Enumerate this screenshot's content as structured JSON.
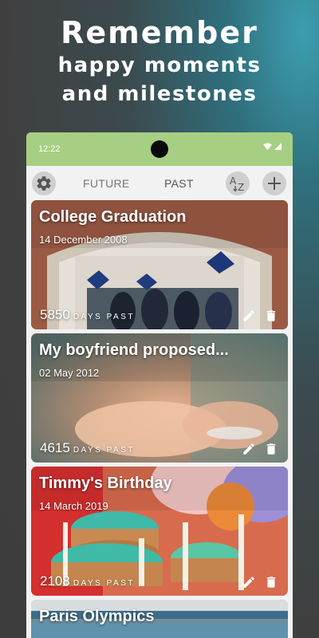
{
  "promo": {
    "title": "Remember",
    "line1": "happy moments",
    "line2": "and milestones"
  },
  "status": {
    "time": "12:22"
  },
  "tabs": {
    "future": "FUTURE",
    "past": "PAST",
    "active": "past"
  },
  "icons": {
    "settings": "gear-icon",
    "sort": "sort-az-icon",
    "add": "plus-icon",
    "edit": "pencil-icon",
    "delete": "trash-icon"
  },
  "events": [
    {
      "title": "College Graduation",
      "date": "14 December 2008",
      "count": "5850",
      "unit": "DAYS PAST"
    },
    {
      "title": "My boyfriend proposed...",
      "date": "02 May 2012",
      "count": "4615",
      "unit": "DAYS PAST"
    },
    {
      "title": "Timmy's Birthday",
      "date": "14 March 2019",
      "count": "2108",
      "unit": "DAYS PAST"
    },
    {
      "title": "Paris Olympics",
      "date": "",
      "count": "",
      "unit": ""
    }
  ],
  "colors": {
    "status_bar": "#a7cf83",
    "screen_bg": "#f2f2f2",
    "button_bg": "#cfcfcf"
  }
}
